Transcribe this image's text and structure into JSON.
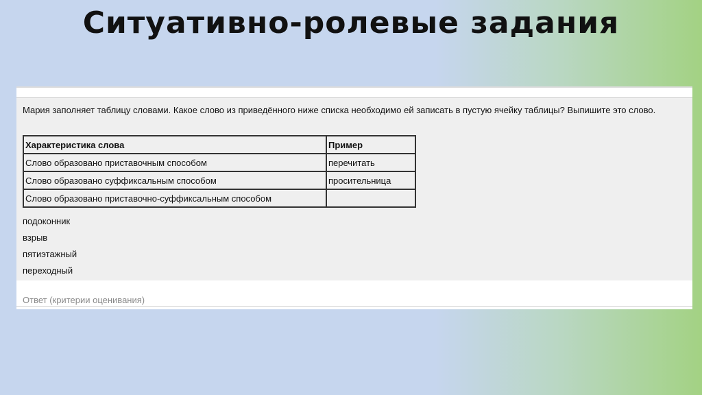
{
  "slide": {
    "title": "Ситуативно-ролевые задания"
  },
  "task": {
    "question": "Мария заполняет таблицу словами. Какое слово из приведённого ниже списка необходимо ей записать в пустую ячейку таблицы? Выпишите это слово.",
    "table": {
      "headers": [
        "Характеристика слова",
        "Пример"
      ],
      "rows": [
        [
          "Слово образовано приставочным способом",
          "перечитать"
        ],
        [
          "Слово образовано суффиксальным способом",
          "просительница"
        ],
        [
          "Слово образовано приставочно-суффиксальным способом",
          ""
        ]
      ]
    },
    "options": [
      "подоконник",
      "взрыв",
      "пятиэтажный",
      "переходный"
    ],
    "answer_link": "Ответ (критерии оценивания)"
  }
}
